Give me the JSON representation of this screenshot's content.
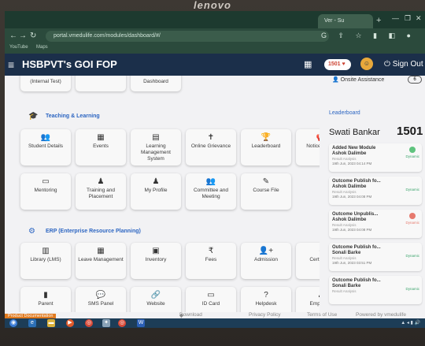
{
  "device": {
    "brand": "lenovo"
  },
  "browser": {
    "tab_label": "Ver - Su",
    "url": "portal.vmedulife.com/modules/dashboard/#/",
    "bookmarks": [
      "YouTube",
      "Maps"
    ]
  },
  "header": {
    "title": "HSBPVT's GOI FOP",
    "points": "1501",
    "signout_label": "Sign Out"
  },
  "right_panel": {
    "onsite_label": "Onsite Assistance",
    "onsite_count": "6",
    "leaderboard_title": "Leaderboard",
    "user_name": "Swati Bankar",
    "user_score": "1501",
    "entries": [
      {
        "title": "Added New Module",
        "name": "Ashok Dalimbe",
        "sub": "Result Analysis",
        "date": "19th Jun, 2023 04:14 PM",
        "tag": "Dynamic"
      },
      {
        "title": "Outcome Publish fo...",
        "name": "Ashok Dalimbe",
        "sub": "Result Analysis",
        "date": "19th Jun, 2023 04:08 PM",
        "tag": "Dynamic"
      },
      {
        "title": "Outcome Unpublis...",
        "name": "Ashok Dalimbe",
        "sub": "Result Analysis",
        "date": "19th Jun, 2023 04:08 PM",
        "tag": "Dynamic"
      },
      {
        "title": "Outcome Publish fo...",
        "name": "Sonali Barke",
        "sub": "Result Analysis",
        "date": "19th Jun, 2023 03:51 PM",
        "tag": "Dynamic"
      },
      {
        "title": "Outcome Publish fo...",
        "name": "Sonali Barke",
        "sub": "Result Analysis",
        "date": "",
        "tag": "Dynamic"
      }
    ]
  },
  "main": {
    "top_row": [
      "(Internal Test)",
      "",
      "Dashboard"
    ],
    "teaching_title": "Teaching & Learning",
    "teaching_row1": [
      "Student Details",
      "Events",
      "Learning Management System",
      "Online Grievance",
      "Leaderboard",
      "Notice Board"
    ],
    "teaching_row2": [
      "Mentoring",
      "Training and Placement",
      "My Profile",
      "Committee and Meeting",
      "Course File"
    ],
    "erp_title": "ERP (Enterprise Resource Planning)",
    "erp_row1": [
      "Library (LMS)",
      "Leave Management",
      "Inventory",
      "Fees",
      "Admission",
      "Certificate"
    ],
    "erp_row2": [
      "Parent",
      "SMS Panel",
      "Website",
      "ID Card",
      "Helpdesk",
      "Employee"
    ]
  },
  "footer": {
    "product_doc": "Product Documentation",
    "download_app": "Download App",
    "privacy": "Privacy Policy",
    "terms": "Terms of Use",
    "powered": "Powered by vmedulife"
  }
}
